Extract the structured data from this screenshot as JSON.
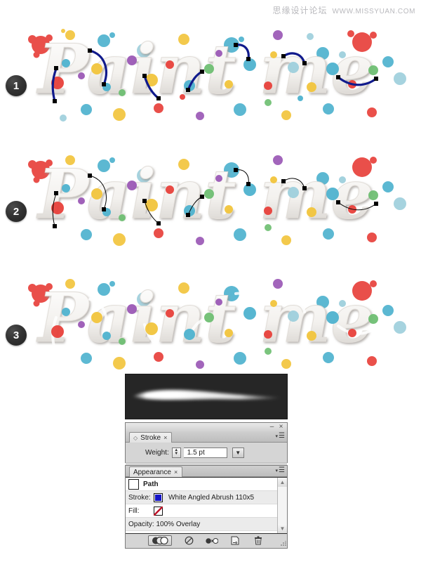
{
  "watermark": {
    "forum_name": "思缘设计论坛",
    "url": "WWW.MISSYUAN.COM"
  },
  "steps": [
    {
      "number": "1",
      "artwork_text": "Paint me",
      "description": "paths with blue angled calligraphic brush strokes and visible anchor points"
    },
    {
      "number": "2",
      "artwork_text": "Paint me",
      "description": "paths reduced to thin black hairlines with anchor points"
    },
    {
      "number": "3",
      "artwork_text": "Paint me",
      "description": "final artwork with highlight strokes applied, no paths visible"
    }
  ],
  "brush_preview": {
    "name": "brush-stroke-preview",
    "background": "#262626",
    "stroke_color": "#ffffff"
  },
  "stroke_panel": {
    "tab_label": "Stroke",
    "tab_close": "×",
    "minimize": "–",
    "close": "×",
    "weight_label": "Weight:",
    "weight_value": "1.5 pt",
    "stepper_up": "▲",
    "stepper_down": "▼",
    "combo_arrow": "⌵"
  },
  "appearance_panel": {
    "tab_label": "Appearance",
    "tab_close": "×",
    "rows": [
      {
        "label": "Path",
        "type": "header"
      },
      {
        "label": "Stroke:",
        "swatch": "blue",
        "value": "White Angled Abrush 110x5"
      },
      {
        "label": "Fill:",
        "swatch": "none",
        "value": ""
      },
      {
        "label": "Opacity: 100% Overlay",
        "type": "opacity"
      }
    ],
    "scroll_up": "▲",
    "scroll_down": "▼",
    "footer_icons": [
      {
        "name": "new-art-basic-appearance-icon",
        "glyph": "◐◑●"
      },
      {
        "name": "clear-appearance-icon",
        "glyph": "⊘"
      },
      {
        "name": "reduce-to-basic-appearance-icon",
        "glyph": "◐▸○"
      },
      {
        "name": "duplicate-selected-item-icon",
        "glyph": "❐"
      },
      {
        "name": "delete-selected-item-icon",
        "glyph": "Ὕ1"
      }
    ]
  },
  "colors": {
    "badge_bg": "#333333",
    "badge_text": "#ffffff",
    "panel_bg": "#d5d5d5",
    "stroke_swatch": "#1414c8",
    "fill_none_slash": "#c0152b",
    "path_blue": "#101a8c",
    "path_black": "#000000"
  }
}
